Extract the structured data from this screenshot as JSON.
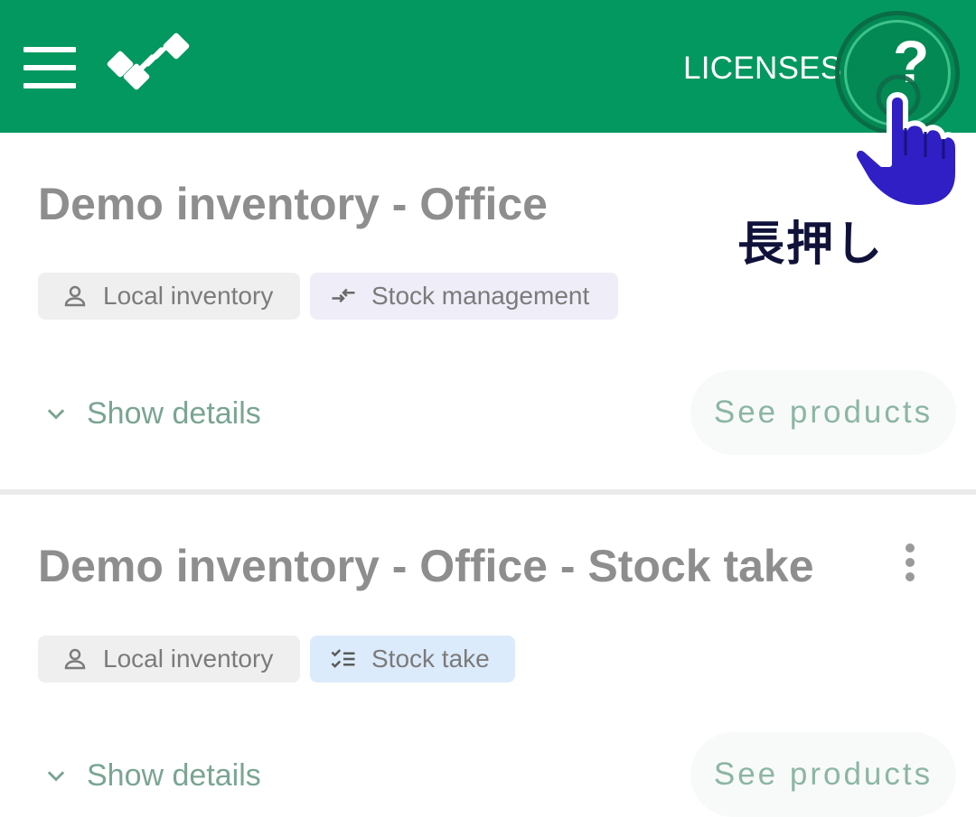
{
  "appbar": {
    "licenses_label": "LICENSES",
    "help_label": "?",
    "background_color": "#03985f"
  },
  "overlay": {
    "long_press_label": "長押し",
    "hand_color": "#2f1fc4"
  },
  "inventories": [
    {
      "title": "Demo inventory - Office",
      "chips": [
        {
          "label": "Local inventory",
          "icon": "person-icon"
        },
        {
          "label": "Stock management",
          "icon": "stock-arrows-icon"
        }
      ],
      "show_details_label": "Show details",
      "see_products_label": "See products"
    },
    {
      "title": "Demo inventory - Office - Stock take",
      "chips": [
        {
          "label": "Local inventory",
          "icon": "person-icon"
        },
        {
          "label": "Stock take",
          "icon": "checklist-icon"
        }
      ],
      "show_details_label": "Show details",
      "see_products_label": "See products"
    }
  ]
}
